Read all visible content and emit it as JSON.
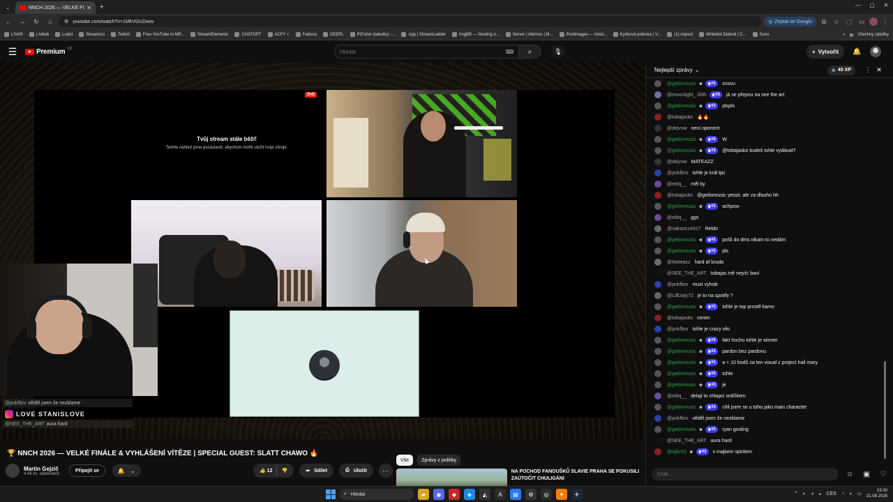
{
  "browser": {
    "tab_title": "NNCH 2026 — VELKÉ FI...",
    "url": "youtube.com/watch?v=1MkVt2uOxeo",
    "ask_google": "Zeptat se Googlu",
    "bookmarks": [
      "LIVAR",
      "| Adlab",
      "Ludot",
      "Streamcci",
      "Twitch",
      "Free YouTube to MP...",
      "StreamElements",
      "CHATGPT",
      "ACFY +",
      "Faktura",
      "DEEPL",
      "PO'sbor (tabulky) -...",
      "App | StreamLadder",
      "ImgBB — Hosting o...",
      "Server | Aternos | M...",
      "Postimages — hosti...",
      "Kyšková polévka | V...",
      "(1) nopsel",
      "Whitelist žádosti | C...",
      "Suno"
    ],
    "all_bookmarks": "Všechny záložky"
  },
  "header": {
    "logo_text": "Premium",
    "logo_region": "CZ",
    "search_placeholder": "Hledat",
    "create_label": "Vytvořit"
  },
  "stream": {
    "live_label": "ŽIVĚ",
    "paused_title": "Tvůj stream stále běží!",
    "paused_subtitle": "Tenhle náhled jsme pozastavili, abychom mohli uložit tvoje zdroje.",
    "overlay_lines": [
      {
        "user": "@pnkfbro",
        "text": "věděl jsem že nezklame"
      },
      {
        "user": "@SEE_THE_ART",
        "text": "aura hard"
      }
    ],
    "overlay_banner": "LOVE STANISLOVE"
  },
  "video": {
    "title": "🏆 NNCH 2026 — VELKÉ FINÁLE & VYHLÁŠENÍ VÍTĚZE | SPECIAL GUEST: SLATT CHAWO 🔥",
    "channel_name": "Martin Gejzič",
    "subscribers": "4,46 tis. odběratelů",
    "join_label": "Připojit se",
    "likes": "12",
    "share_label": "Sdílet",
    "save_label": "Uložit"
  },
  "recommendations": {
    "chips": [
      "Vše",
      "Zprávy z politiky"
    ],
    "first_title": "NA POCHOD FANOUŠKŮ SLAVIE PRAHA SE POKUSILI ZAÚTOČIT CHULIGÁNI"
  },
  "chat": {
    "mode_label": "Nejlepší zprávy",
    "xp": "40 XP",
    "input_placeholder": "Chat...",
    "messages": [
      {
        "user": "@getiixmusic",
        "member": true,
        "badge": "#1",
        "text": "znovu",
        "color": "#555"
      },
      {
        "user": "@moonlight_.30th",
        "member": false,
        "badge": "#3",
        "text": "já se přepnu na see the art",
        "color": "#7a6aa0"
      },
      {
        "user": "@getiixmusic",
        "member": true,
        "badge": "#1",
        "text": "plspls",
        "color": "#555"
      },
      {
        "user": "@tobajasko",
        "member": false,
        "badge": "",
        "text": "🔥🔥",
        "color": "#8a1f1f"
      },
      {
        "user": "@dejvvw",
        "member": false,
        "badge": "",
        "text": "není oponent",
        "color": "#333"
      },
      {
        "user": "@getiixmusic",
        "member": true,
        "badge": "#1",
        "text": "W",
        "color": "#555"
      },
      {
        "user": "@getiixmusic",
        "member": true,
        "badge": "#1",
        "text": "@tobajasko budeš tohle vydávat?",
        "color": "#555"
      },
      {
        "user": "@dejvvw",
        "member": false,
        "badge": "",
        "text": "MATEAZZ",
        "color": "#333"
      },
      {
        "user": "@pnkfbro",
        "member": false,
        "badge": "",
        "text": "tohle je král tpc",
        "color": "#2b3fb0"
      },
      {
        "user": "@eldq__",
        "member": false,
        "badge": "",
        "text": "měl by",
        "color": "#6a4c9c"
      },
      {
        "user": "@tobajasko",
        "member": false,
        "badge": "",
        "text": "@getiixmusic yessir, ale za dlouho hh",
        "color": "#8a1f1f"
      },
      {
        "user": "@getiixmusic",
        "member": true,
        "badge": "#1",
        "text": "achjooo",
        "color": "#555"
      },
      {
        "user": "@eldq__",
        "member": false,
        "badge": "",
        "text": "ggs",
        "color": "#6a4c9c"
      },
      {
        "user": "@nakaricz4617",
        "member": false,
        "badge": "",
        "text": "Reldn",
        "color": "#666"
      },
      {
        "user": "@getiixmusic",
        "member": true,
        "badge": "#1",
        "text": "pošli do dms nikam to nedám",
        "color": "#555"
      },
      {
        "user": "@getiixmusic",
        "member": true,
        "badge": "#1",
        "text": "pls",
        "color": "#555"
      },
      {
        "user": "@Mateazz",
        "member": false,
        "badge": "",
        "text": "hard af bruda",
        "color": "#5a7a5a"
      },
      {
        "user": "@SEE_THE_ART",
        "member": false,
        "badge": "",
        "text": "tobajas mě nejvíc baví",
        "color": "#111"
      },
      {
        "user": "@pnkfbro",
        "member": false,
        "badge": "",
        "text": "musí vyhrát",
        "color": "#2b3fb0"
      },
      {
        "user": "@LillDaty72",
        "member": false,
        "badge": "",
        "text": "je to na spotify ?",
        "color": "#666"
      },
      {
        "user": "@getiixmusic",
        "member": true,
        "badge": "#1",
        "text": "tohle je top prostě kamo",
        "color": "#555"
      },
      {
        "user": "@tobajasko",
        "member": false,
        "badge": "",
        "text": "cenim",
        "color": "#8a1f1f"
      },
      {
        "user": "@pnkfbro",
        "member": false,
        "badge": "",
        "text": "tohle je crazy věc",
        "color": "#2b3fb0"
      },
      {
        "user": "@getiixmusic",
        "member": true,
        "badge": "#1",
        "text": "fakt hochu tohle je winner",
        "color": "#555"
      },
      {
        "user": "@getiixmusic",
        "member": true,
        "badge": "#1",
        "text": "pardon bez pardonu",
        "color": "#555"
      },
      {
        "user": "@getiixmusic",
        "member": true,
        "badge": "#1",
        "text": "a + 10 bodů za ten visual z project hail mary",
        "color": "#555"
      },
      {
        "user": "@getiixmusic",
        "member": true,
        "badge": "#1",
        "text": "tohle",
        "color": "#555"
      },
      {
        "user": "@getiixmusic",
        "member": true,
        "badge": "#1",
        "text": "je",
        "color": "#555"
      },
      {
        "user": "@eldq__",
        "member": false,
        "badge": "",
        "text": "delají to chlapci srdíčkem",
        "color": "#6a4c9c"
      },
      {
        "user": "@getiixmusic",
        "member": true,
        "badge": "#1",
        "text": "cítil jsem se u toho jako main character",
        "color": "#555"
      },
      {
        "user": "@pnkfbro",
        "member": false,
        "badge": "",
        "text": "věděl jsem že nezklame",
        "color": "#2b3fb0"
      },
      {
        "user": "@getiixmusic",
        "member": true,
        "badge": "#1",
        "text": "ryan gosling",
        "color": "#555"
      },
      {
        "user": "@SEE_THE_ART",
        "member": false,
        "badge": "",
        "text": "aura hard",
        "color": "#111"
      },
      {
        "user": "@lajbr01",
        "member": true,
        "badge": "#2",
        "text": "s majkem spiritem",
        "color": "#8a1f1f"
      }
    ]
  },
  "taskbar": {
    "search_label": "Hledat",
    "lang": "CES",
    "time": "19:30",
    "date": "31.08.2026"
  }
}
